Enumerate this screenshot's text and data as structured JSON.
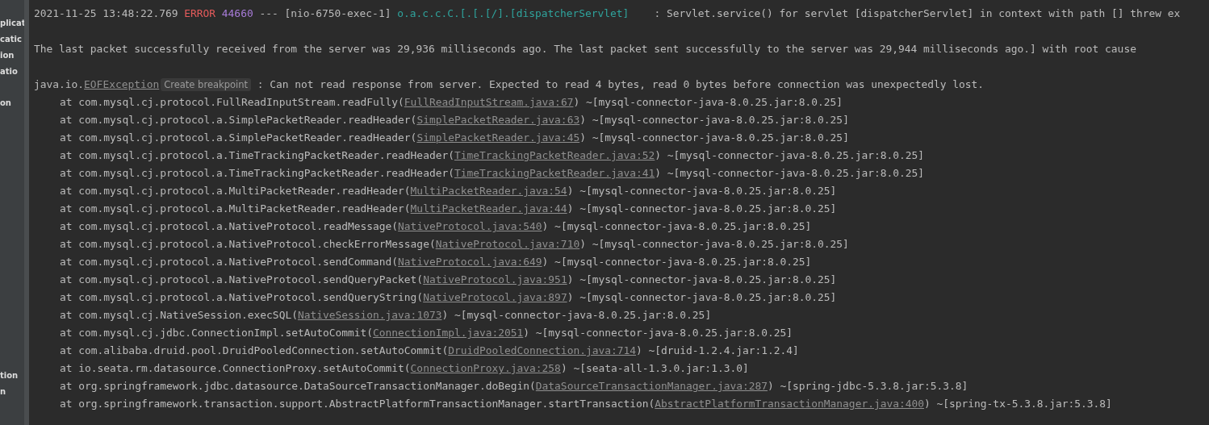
{
  "sidebar": {
    "top_items": [
      "plicat",
      "catic",
      "ion",
      "atio",
      "on"
    ],
    "bottom_items": [
      "tion",
      "n"
    ]
  },
  "console": {
    "lines": [
      {
        "kind": "header",
        "timestamp": "2021-11-25 13:48:22.769",
        "level": "ERROR",
        "pid": "44660",
        "thread": "--- [nio-6750-exec-1]",
        "logger": "o.a.c.c.C.[.[.[/].[dispatcherServlet]",
        "message": "   : Servlet.service() for servlet [dispatcherServlet] in context with path [] threw ex"
      },
      {
        "kind": "blank"
      },
      {
        "kind": "text",
        "text": "The last packet successfully received from the server was 29,936 milliseconds ago. The last packet sent successfully to the server was 29,944 milliseconds ago.] with root cause"
      },
      {
        "kind": "blank"
      },
      {
        "kind": "exception",
        "before": "java.io.",
        "link": "EOFException",
        "hint": "Create breakpoint",
        "after": ": Can not read response from server. Expected to read 4 bytes, read 0 bytes before connection was unexpectedly lost."
      },
      {
        "kind": "frame",
        "before": "at com.mysql.cj.protocol.FullReadInputStream.readFully(",
        "link": "FullReadInputStream.java:67",
        "after": ") ~[mysql-connector-java-8.0.25.jar:8.0.25]"
      },
      {
        "kind": "frame",
        "before": "at com.mysql.cj.protocol.a.SimplePacketReader.readHeader(",
        "link": "SimplePacketReader.java:63",
        "after": ") ~[mysql-connector-java-8.0.25.jar:8.0.25]"
      },
      {
        "kind": "frame",
        "before": "at com.mysql.cj.protocol.a.SimplePacketReader.readHeader(",
        "link": "SimplePacketReader.java:45",
        "after": ") ~[mysql-connector-java-8.0.25.jar:8.0.25]"
      },
      {
        "kind": "frame",
        "before": "at com.mysql.cj.protocol.a.TimeTrackingPacketReader.readHeader(",
        "link": "TimeTrackingPacketReader.java:52",
        "after": ") ~[mysql-connector-java-8.0.25.jar:8.0.25]"
      },
      {
        "kind": "frame",
        "before": "at com.mysql.cj.protocol.a.TimeTrackingPacketReader.readHeader(",
        "link": "TimeTrackingPacketReader.java:41",
        "after": ") ~[mysql-connector-java-8.0.25.jar:8.0.25]"
      },
      {
        "kind": "frame",
        "before": "at com.mysql.cj.protocol.a.MultiPacketReader.readHeader(",
        "link": "MultiPacketReader.java:54",
        "after": ") ~[mysql-connector-java-8.0.25.jar:8.0.25]"
      },
      {
        "kind": "frame",
        "before": "at com.mysql.cj.protocol.a.MultiPacketReader.readHeader(",
        "link": "MultiPacketReader.java:44",
        "after": ") ~[mysql-connector-java-8.0.25.jar:8.0.25]"
      },
      {
        "kind": "frame",
        "before": "at com.mysql.cj.protocol.a.NativeProtocol.readMessage(",
        "link": "NativeProtocol.java:540",
        "after": ") ~[mysql-connector-java-8.0.25.jar:8.0.25]"
      },
      {
        "kind": "frame",
        "before": "at com.mysql.cj.protocol.a.NativeProtocol.checkErrorMessage(",
        "link": "NativeProtocol.java:710",
        "after": ") ~[mysql-connector-java-8.0.25.jar:8.0.25]"
      },
      {
        "kind": "frame",
        "before": "at com.mysql.cj.protocol.a.NativeProtocol.sendCommand(",
        "link": "NativeProtocol.java:649",
        "after": ") ~[mysql-connector-java-8.0.25.jar:8.0.25]"
      },
      {
        "kind": "frame",
        "before": "at com.mysql.cj.protocol.a.NativeProtocol.sendQueryPacket(",
        "link": "NativeProtocol.java:951",
        "after": ") ~[mysql-connector-java-8.0.25.jar:8.0.25]"
      },
      {
        "kind": "frame",
        "before": "at com.mysql.cj.protocol.a.NativeProtocol.sendQueryString(",
        "link": "NativeProtocol.java:897",
        "after": ") ~[mysql-connector-java-8.0.25.jar:8.0.25]"
      },
      {
        "kind": "frame",
        "before": "at com.mysql.cj.NativeSession.execSQL(",
        "link": "NativeSession.java:1073",
        "after": ") ~[mysql-connector-java-8.0.25.jar:8.0.25]"
      },
      {
        "kind": "frame",
        "before": "at com.mysql.cj.jdbc.ConnectionImpl.setAutoCommit(",
        "link": "ConnectionImpl.java:2051",
        "after": ") ~[mysql-connector-java-8.0.25.jar:8.0.25]"
      },
      {
        "kind": "frame",
        "before": "at com.alibaba.druid.pool.DruidPooledConnection.setAutoCommit(",
        "link": "DruidPooledConnection.java:714",
        "after": ") ~[druid-1.2.4.jar:1.2.4]"
      },
      {
        "kind": "frame",
        "before": "at io.seata.rm.datasource.ConnectionProxy.setAutoCommit(",
        "link": "ConnectionProxy.java:258",
        "after": ") ~[seata-all-1.3.0.jar:1.3.0]"
      },
      {
        "kind": "frame",
        "before": "at org.springframework.jdbc.datasource.DataSourceTransactionManager.doBegin(",
        "link": "DataSourceTransactionManager.java:287",
        "after": ") ~[spring-jdbc-5.3.8.jar:5.3.8]"
      },
      {
        "kind": "frame",
        "before": "at org.springframework.transaction.support.AbstractPlatformTransactionManager.startTransaction(",
        "link": "AbstractPlatformTransactionManager.java:400",
        "after": ") ~[spring-tx-5.3.8.jar:5.3.8]"
      }
    ]
  }
}
